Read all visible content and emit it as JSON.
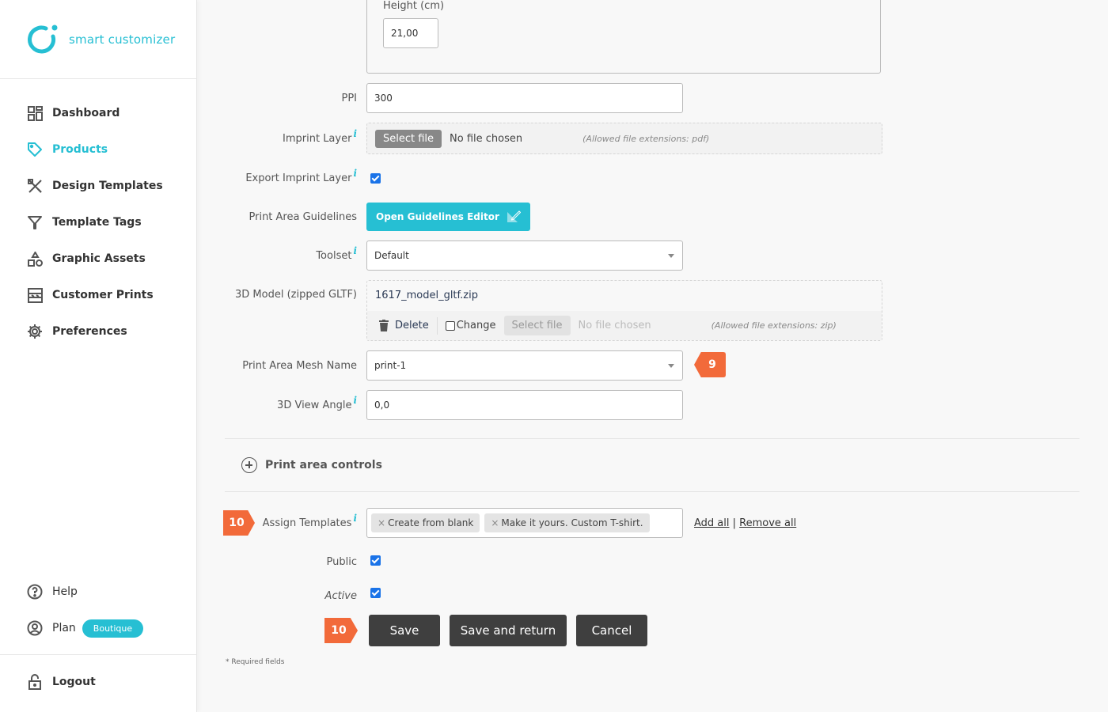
{
  "brand": {
    "name": "smart customizer",
    "accent_color": "#26bfd3",
    "badge_color": "#f26a3a"
  },
  "sidebar": {
    "items": [
      {
        "label": "Dashboard",
        "icon": "dashboard-icon",
        "active": false
      },
      {
        "label": "Products",
        "icon": "tag-icon",
        "active": true
      },
      {
        "label": "Design Templates",
        "icon": "design-tools-icon",
        "active": false
      },
      {
        "label": "Template Tags",
        "icon": "filter-icon",
        "active": false
      },
      {
        "label": "Graphic Assets",
        "icon": "shapes-icon",
        "active": false
      },
      {
        "label": "Customer Prints",
        "icon": "prints-icon",
        "active": false
      },
      {
        "label": "Preferences",
        "icon": "gear-icon",
        "active": false
      }
    ],
    "help_label": "Help",
    "plan_label": "Plan",
    "plan_badge": "Boutique",
    "logout_label": "Logout"
  },
  "form": {
    "dimensions": {
      "height_label": "Height (cm)",
      "height_value": "21,00"
    },
    "ppi": {
      "label": "PPI",
      "value": "300"
    },
    "imprint_layer": {
      "label": "Imprint Layer",
      "info": "i",
      "button": "Select file",
      "status": "No file chosen",
      "allowed": "(Allowed file extensions: pdf)"
    },
    "export_imprint_layer": {
      "label": "Export Imprint Layer",
      "info": "i",
      "checked": true
    },
    "print_area_guidelines": {
      "label": "Print Area Guidelines",
      "button": "Open Guidelines Editor"
    },
    "toolset": {
      "label": "Toolset",
      "info": "i",
      "value": "Default"
    },
    "model_3d": {
      "label": "3D Model (zipped GLTF)",
      "file_name": "1617_model_gltf.zip",
      "delete_label": "Delete",
      "change_label": "Change",
      "change_checked": false,
      "button": "Select file",
      "status": "No file chosen",
      "allowed": "(Allowed file extensions: zip)"
    },
    "mesh_name": {
      "label": "Print Area Mesh Name",
      "value": "print-1"
    },
    "view_angle": {
      "label": "3D View Angle",
      "info": "i",
      "value": "0,0"
    },
    "print_area_controls": {
      "label": "Print area controls"
    },
    "assign_templates": {
      "label": "Assign Templates",
      "info": "i",
      "tags": [
        "Create from blank",
        "Make it yours. Custom T-shirt."
      ],
      "tag_remove": "×",
      "add_all": "Add all",
      "separator": "|",
      "remove_all": "Remove all"
    },
    "public": {
      "label": "Public",
      "checked": true
    },
    "active": {
      "label": "Active",
      "checked": true
    },
    "buttons": {
      "save": "Save",
      "save_return": "Save and return",
      "cancel": "Cancel"
    },
    "required_note": "* Required fields"
  },
  "annotations": {
    "step_9": "9",
    "step_10a": "10",
    "step_10b": "10"
  }
}
